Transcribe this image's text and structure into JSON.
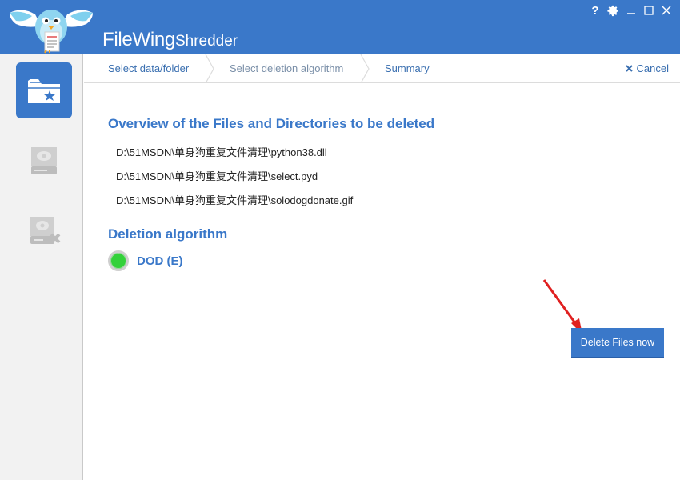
{
  "app": {
    "brand": "FileWing",
    "product": "Shredder"
  },
  "window_controls": {
    "help": "?",
    "icons": [
      "gear-icon",
      "minimize-icon",
      "maximize-icon",
      "close-icon"
    ]
  },
  "sidebar": {
    "items": [
      {
        "name": "select-folder",
        "icon": "folder-star-icon",
        "active": true
      },
      {
        "name": "select-drive",
        "icon": "drive-icon",
        "active": false
      },
      {
        "name": "drive-delete",
        "icon": "drive-delete-icon",
        "active": false
      }
    ]
  },
  "steps": [
    {
      "label": "Select data/folder"
    },
    {
      "label": "Select deletion algorithm"
    },
    {
      "label": "Summary"
    }
  ],
  "cancel_label": "Cancel",
  "overview": {
    "title": "Overview of the Files and Directories to be deleted",
    "files": [
      "D:\\51MSDN\\单身狗重复文件清理\\python38.dll",
      "D:\\51MSDN\\单身狗重复文件清理\\select.pyd",
      "D:\\51MSDN\\单身狗重复文件清理\\solodogdonate.gif"
    ]
  },
  "algorithm": {
    "title": "Deletion algorithm",
    "selected": "DOD (E)",
    "status_color": "#33d13a"
  },
  "actions": {
    "delete_label": "Delete Files now"
  },
  "colors": {
    "accent": "#3a78c9",
    "annotation_arrow": "#e02020"
  }
}
